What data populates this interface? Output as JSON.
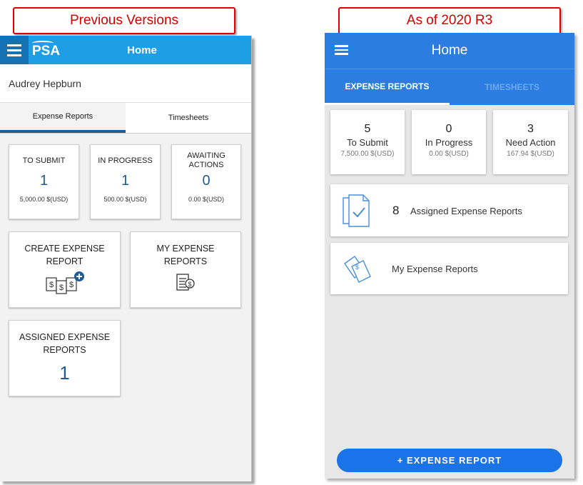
{
  "callouts": {
    "left": "Previous Versions",
    "right": "As of 2020 R3"
  },
  "left": {
    "logo": "PSA",
    "title": "Home",
    "user": "Audrey Hepburn",
    "tabs": [
      {
        "label": "Expense Reports",
        "active": true
      },
      {
        "label": "Timesheets",
        "active": false
      }
    ],
    "stats": [
      {
        "label": "TO SUBMIT",
        "count": "1",
        "amount": "5,000.00 $(USD)"
      },
      {
        "label": "IN PROGRESS",
        "count": "1",
        "amount": "500.00 $(USD)"
      },
      {
        "label": "AWAITING ACTIONS",
        "count": "0",
        "amount": "0.00 $(USD)"
      }
    ],
    "create_report": "CREATE EXPENSE REPORT",
    "my_reports": "MY EXPENSE REPORTS",
    "assigned": {
      "label": "ASSIGNED EXPENSE REPORTS",
      "count": "1"
    }
  },
  "right": {
    "title": "Home",
    "tabs": [
      {
        "label": "EXPENSE REPORTS",
        "active": true
      },
      {
        "label": "TIMESHEETS",
        "active": false
      }
    ],
    "stats": [
      {
        "count": "5",
        "label": "To Submit",
        "amount": "7,500.00 $(USD)"
      },
      {
        "count": "0",
        "label": "In Progress",
        "amount": "0.00 $(USD)"
      },
      {
        "count": "3",
        "label": "Need Action",
        "amount": "167.94 $(USD)"
      }
    ],
    "assigned": {
      "count": "8",
      "label": "Assigned Expense Reports"
    },
    "my_reports": "My Expense Reports",
    "fab": "+ EXPENSE REPORT"
  },
  "colors": {
    "callout_red": "#d40000",
    "old_header": "#1d9ee5",
    "new_header": "#2b7de1",
    "accent_navy": "#1f5c96",
    "fab_blue": "#1a73e8"
  }
}
